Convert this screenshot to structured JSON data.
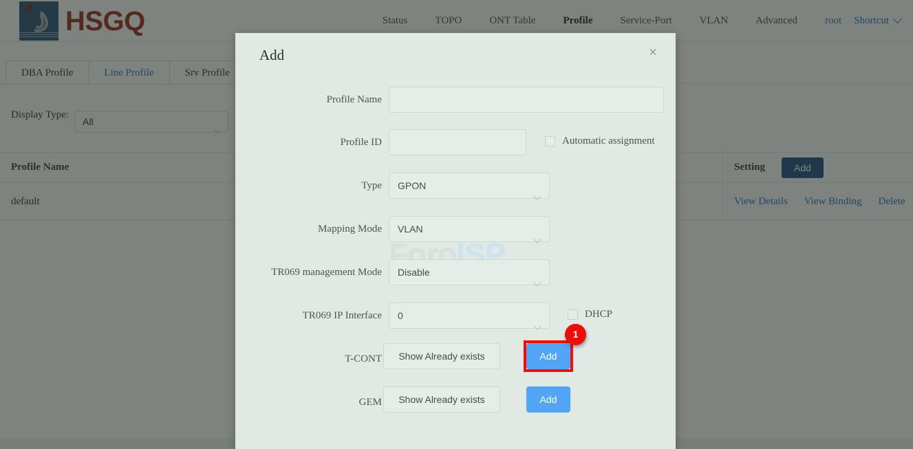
{
  "header": {
    "brand_text": "HSGQ",
    "brand_color": "#9b2b1e",
    "nav": [
      {
        "label": "Status",
        "active": false
      },
      {
        "label": "TOPO",
        "active": false
      },
      {
        "label": "ONT Table",
        "active": false
      },
      {
        "label": "Profile",
        "active": true
      },
      {
        "label": "Service-Port",
        "active": false
      },
      {
        "label": "VLAN",
        "active": false
      },
      {
        "label": "Advanced",
        "active": false
      }
    ],
    "user_label": "root",
    "shortcut_label": "Shortcut"
  },
  "tabs": [
    {
      "label": "DBA Profile",
      "active": false
    },
    {
      "label": "Line Profile",
      "active": true
    },
    {
      "label": "Srv Profile",
      "active": false
    }
  ],
  "filter": {
    "label": "Display Type:",
    "value": "All"
  },
  "table": {
    "columns": [
      "Profile Name",
      "Setting"
    ],
    "header_add_label": "Add",
    "rows": [
      {
        "profile_name": "default",
        "actions": [
          "View Details",
          "View Binding",
          "Delete"
        ]
      }
    ]
  },
  "modal": {
    "title": "Add",
    "close_label": "×",
    "watermark": {
      "part1": "Foro",
      "part2": "ISP"
    },
    "fields": {
      "profile_name": {
        "label": "Profile Name",
        "value": "",
        "placeholder": ""
      },
      "profile_id": {
        "label": "Profile ID",
        "value": "",
        "placeholder": ""
      },
      "automatic_assignment": {
        "label": "Automatic assignment",
        "checked": false
      },
      "type": {
        "label": "Type",
        "value": "GPON"
      },
      "mapping_mode": {
        "label": "Mapping Mode",
        "value": "VLAN"
      },
      "tr069_management_mode": {
        "label": "TR069 management Mode",
        "value": "Disable"
      },
      "tr069_ip_interface": {
        "label": "TR069 IP Interface",
        "value": "0"
      },
      "dhcp": {
        "label": "DHCP",
        "checked": false
      },
      "tcont": {
        "label": "T-CONT",
        "show_label": "Show Already exists",
        "add_label": "Add",
        "highlight_badge": "1"
      },
      "gem": {
        "label": "GEM",
        "show_label": "Show Already exists",
        "add_label": "Add"
      }
    }
  },
  "colors": {
    "accent_blue": "#52a4f5",
    "link_blue": "#2a6ebb",
    "dark_blue": "#1d4f80",
    "highlight_red": "#ec0d0d",
    "modal_bg": "#dfeae4"
  }
}
